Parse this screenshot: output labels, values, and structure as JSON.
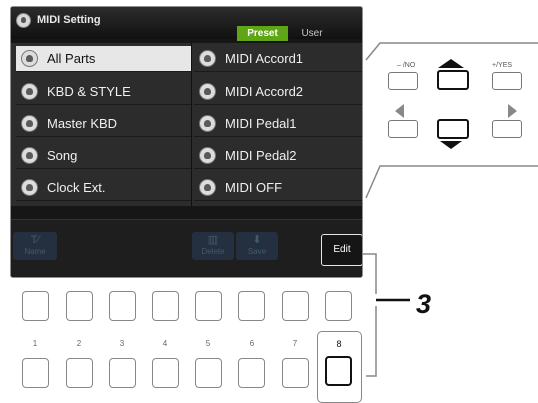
{
  "display": {
    "title": "MIDI Setting",
    "tabs": [
      "Preset",
      "User"
    ],
    "items": [
      {
        "label": "All Parts"
      },
      {
        "label": "KBD & STYLE"
      },
      {
        "label": "Master KBD"
      },
      {
        "label": "Song"
      },
      {
        "label": "Clock Ext."
      },
      {
        "label": "MIDI Accord1"
      },
      {
        "label": "MIDI Accord2"
      },
      {
        "label": "MIDI Pedal1"
      },
      {
        "label": "MIDI Pedal2"
      },
      {
        "label": "MIDI OFF"
      }
    ],
    "bottom_buttons": {
      "name": "Name",
      "delete": "Delete",
      "save": "Save",
      "edit": "Edit"
    }
  },
  "panel": {
    "no_label": "– /NO",
    "yes_label": "+/YES",
    "number_labels": [
      "1",
      "2",
      "3",
      "4",
      "5",
      "6",
      "7",
      "8"
    ],
    "callout": "3"
  }
}
